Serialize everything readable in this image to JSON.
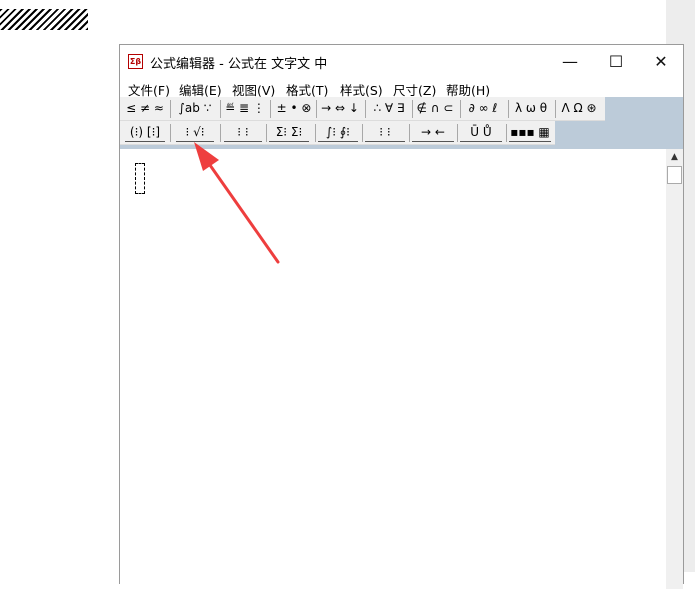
{
  "window": {
    "app_icon_text": "Σβ",
    "title": "公式编辑器 - 公式在 文字文 中",
    "minimize_glyph": "—",
    "maximize_glyph": "☐",
    "close_glyph": "✕"
  },
  "menu": [
    "文件(F)",
    "编辑(E)",
    "视图(V)",
    "格式(T)",
    "样式(S)",
    "尺寸(Z)",
    "帮助(H)"
  ],
  "toolbar_row1": [
    "≤ ≠ ≈",
    "∫ab ∵",
    "≝ ≣ ⋮",
    "± • ⊗",
    "→ ⇔ ↓",
    "∴ ∀ ∃",
    "∉ ∩ ⊂",
    "∂ ∞ ℓ",
    "λ ω θ",
    "Λ Ω ⊛"
  ],
  "toolbar_row2": [
    "(⁝) [⁝]",
    "⁝ √⁝",
    "⁝ ⁝",
    "Σ⁝ Σ⁝",
    "∫⁝ ∮⁝",
    "⁝ ⁝",
    "→ ←",
    "Ū Ů",
    "▪▪▪ ▦"
  ],
  "scrollbar": {
    "up_glyph": "▲"
  },
  "colors": {
    "toolbar_background": "#f0f0f0",
    "toolbar_area_fill": "#bccbd9",
    "annotation_arrow": "#ee3e3e"
  }
}
